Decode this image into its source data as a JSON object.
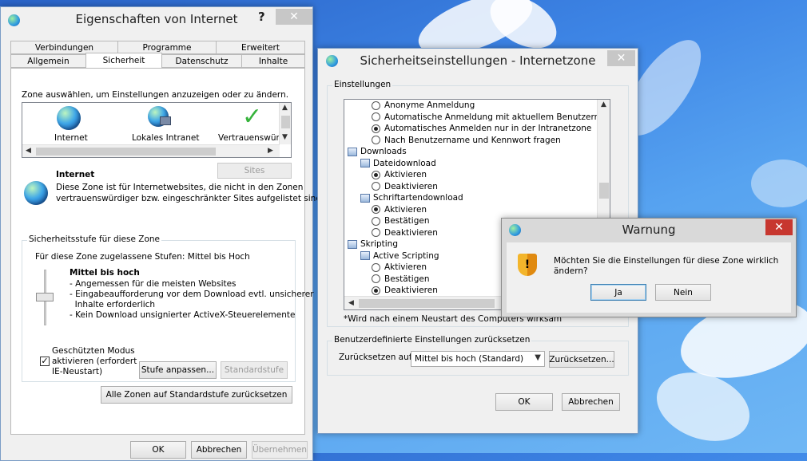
{
  "internet_props": {
    "title": "Eigenschaften von Internet",
    "help": "?",
    "close": "✕",
    "tabs_row1": [
      "Verbindungen",
      "Programme",
      "Erweitert"
    ],
    "tabs_row2": [
      "Allgemein",
      "Sicherheit",
      "Datenschutz",
      "Inhalte"
    ],
    "zone_prompt": "Zone auswählen, um Einstellungen anzuzeigen oder zu ändern.",
    "zones": [
      "Internet",
      "Lokales Intranet",
      "Vertrauenswürd"
    ],
    "sites_button": "Sites",
    "zone_heading": "Internet",
    "zone_desc_1": "Diese Zone ist für Internetwebsites, die nicht in den Zonen",
    "zone_desc_2": "vertrauenswürdiger bzw. eingeschränkter Sites aufgelistet sind.",
    "level_group": "Sicherheitsstufe für diese Zone",
    "allowed_levels": "Für diese Zone zugelassene Stufen: Mittel bis Hoch",
    "level_name": "Mittel bis hoch",
    "level_points": [
      "- Angemessen für die meisten Websites",
      "- Eingabeaufforderung vor dem Download evtl. unsicherer",
      "  Inhalte erforderlich",
      "- Kein Download unsignierter ActiveX-Steuerelemente"
    ],
    "protected_mode_lines": [
      "Geschützten Modus",
      "aktivieren (erfordert",
      "IE-Neustart)"
    ],
    "protected_mode_checked": true,
    "custom_level_button": "Stufe anpassen...",
    "default_level_button": "Standardstufe",
    "reset_all_button": "Alle Zonen auf Standardstufe zurücksetzen",
    "ok": "OK",
    "cancel": "Abbrechen",
    "apply": "Übernehmen"
  },
  "security_settings": {
    "title": "Sicherheitseinstellungen - Internetzone",
    "close": "✕",
    "settings_group": "Einstellungen",
    "tree": [
      {
        "type": "radio",
        "level": 2,
        "label": "Anonyme Anmeldung",
        "checked": false
      },
      {
        "type": "radio",
        "level": 2,
        "label": "Automatische Anmeldung mit aktuellem Benutzernamen u",
        "checked": false
      },
      {
        "type": "radio",
        "level": 2,
        "label": "Automatisches Anmelden nur in der Intranetzone",
        "checked": true
      },
      {
        "type": "radio",
        "level": 2,
        "label": "Nach Benutzername und Kennwort fragen",
        "checked": false
      },
      {
        "type": "folder",
        "level": 0,
        "label": "Downloads"
      },
      {
        "type": "folder",
        "level": 1,
        "label": "Dateidownload"
      },
      {
        "type": "radio",
        "level": 2,
        "label": "Aktivieren",
        "checked": true
      },
      {
        "type": "radio",
        "level": 2,
        "label": "Deaktivieren",
        "checked": false
      },
      {
        "type": "folder",
        "level": 1,
        "label": "Schriftartendownload"
      },
      {
        "type": "radio",
        "level": 2,
        "label": "Aktivieren",
        "checked": true
      },
      {
        "type": "radio",
        "level": 2,
        "label": "Bestätigen",
        "checked": false
      },
      {
        "type": "radio",
        "level": 2,
        "label": "Deaktivieren",
        "checked": false
      },
      {
        "type": "folder",
        "level": 0,
        "label": "Skripting"
      },
      {
        "type": "folder",
        "level": 1,
        "label": "Active Scripting"
      },
      {
        "type": "radio",
        "level": 2,
        "label": "Aktivieren",
        "checked": false
      },
      {
        "type": "radio",
        "level": 2,
        "label": "Bestätigen",
        "checked": false
      },
      {
        "type": "radio",
        "level": 2,
        "label": "Deaktivieren",
        "checked": true
      }
    ],
    "restart_note": "*Wird nach einem Neustart des Computers wirksam",
    "reset_group": "Benutzerdefinierte Einstellungen zurücksetzen",
    "reset_to_label": "Zurücksetzen auf:",
    "reset_to_value": "Mittel bis hoch (Standard)",
    "reset_button": "Zurücksetzen...",
    "ok": "OK",
    "cancel": "Abbrechen"
  },
  "warning": {
    "title": "Warnung",
    "close": "✕",
    "message_1": "Möchten Sie die Einstellungen für diese Zone wirklich",
    "message_2": "ändern?",
    "yes": "Ja",
    "no": "Nein"
  }
}
